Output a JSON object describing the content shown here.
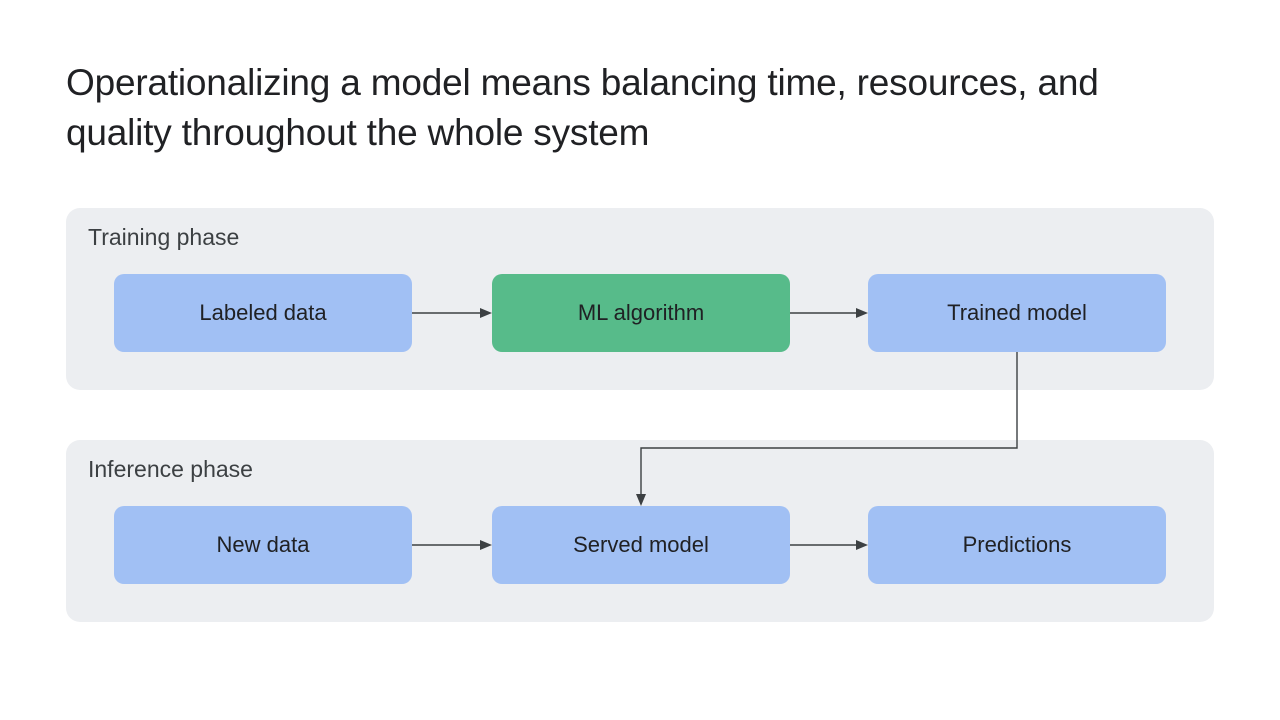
{
  "title": "Operationalizing a model means balancing time, resources, and quality throughout the whole system",
  "phases": {
    "training": {
      "label": "Training phase",
      "nodes": {
        "labeled_data": {
          "label": "Labeled data",
          "color": "blue"
        },
        "ml_algorithm": {
          "label": "ML algorithm",
          "color": "green"
        },
        "trained_model": {
          "label": "Trained model",
          "color": "blue"
        }
      }
    },
    "inference": {
      "label": "Inference phase",
      "nodes": {
        "new_data": {
          "label": "New data",
          "color": "blue"
        },
        "served_model": {
          "label": "Served model",
          "color": "blue"
        },
        "predictions": {
          "label": "Predictions",
          "color": "blue"
        }
      }
    }
  },
  "edges": [
    {
      "from": "labeled_data",
      "to": "ml_algorithm"
    },
    {
      "from": "ml_algorithm",
      "to": "trained_model"
    },
    {
      "from": "trained_model",
      "to": "served_model"
    },
    {
      "from": "new_data",
      "to": "served_model"
    },
    {
      "from": "served_model",
      "to": "predictions"
    }
  ],
  "colors": {
    "panel": "#eceef1",
    "blue": "#a1c0f4",
    "green": "#57bb8a",
    "arrow": "#3c4043"
  }
}
